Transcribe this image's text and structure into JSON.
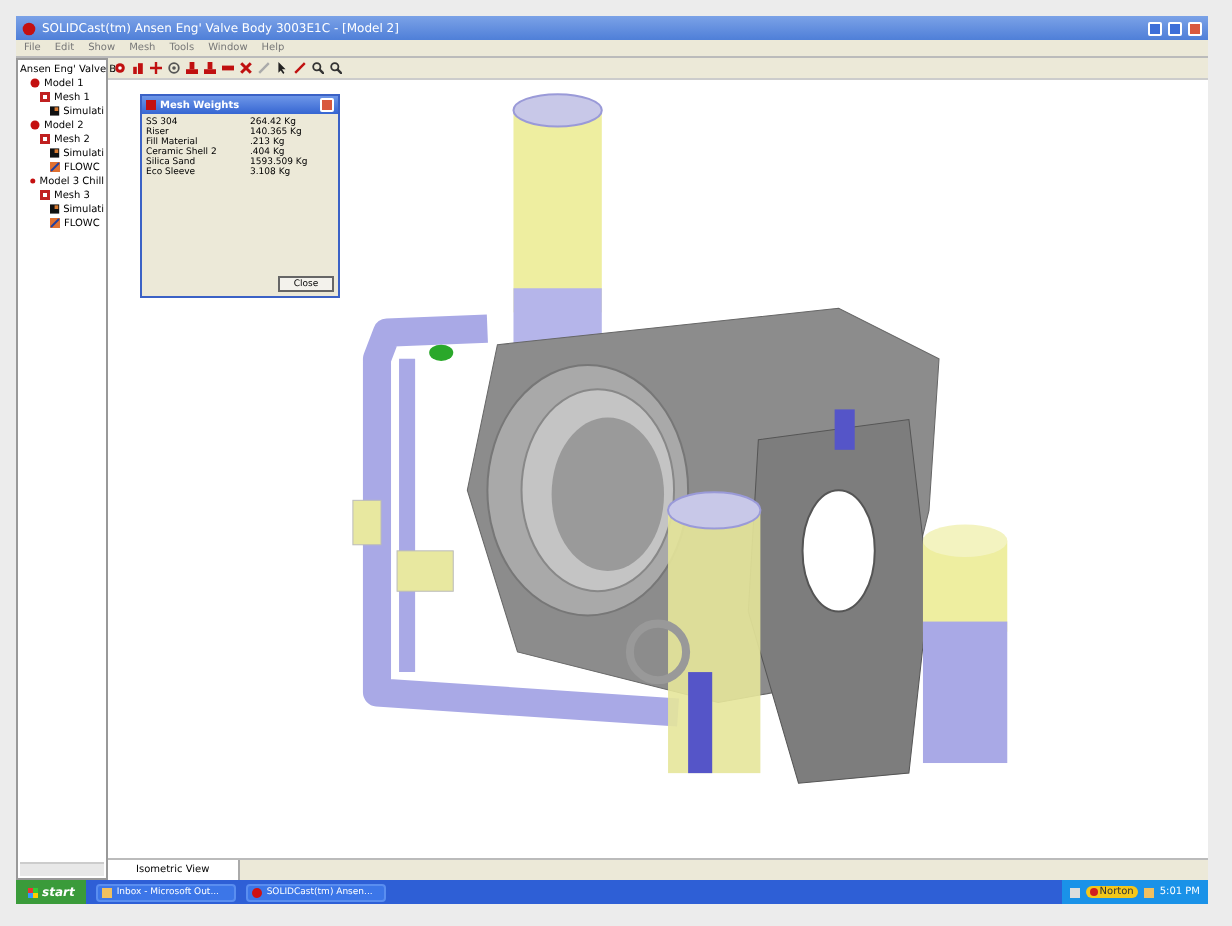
{
  "window": {
    "title": "SOLIDCast(tm) Ansen Eng' Valve Body 3003E1C - [Model 2]"
  },
  "menu": [
    "File",
    "Edit",
    "Show",
    "Mesh",
    "Tools",
    "Window",
    "Help"
  ],
  "tree": {
    "label": "Ansen Eng' Valve B",
    "children": [
      {
        "label": "Model 1",
        "kind": "model",
        "children": [
          {
            "label": "Mesh 1",
            "kind": "mesh",
            "children": [
              {
                "label": "Simulati",
                "kind": "simulation"
              }
            ]
          }
        ]
      },
      {
        "label": "Model 2",
        "kind": "model",
        "children": [
          {
            "label": "Mesh 2",
            "kind": "mesh",
            "children": [
              {
                "label": "Simulati",
                "kind": "simulation"
              },
              {
                "label": "FLOWC",
                "kind": "flow"
              }
            ]
          }
        ]
      },
      {
        "label": "Model 3 Chill",
        "kind": "model",
        "children": [
          {
            "label": "Mesh 3",
            "kind": "mesh",
            "children": [
              {
                "label": "Simulati",
                "kind": "simulation"
              },
              {
                "label": "FLOWC",
                "kind": "flow"
              }
            ]
          }
        ]
      }
    ]
  },
  "dialog": {
    "title": "Mesh Weights",
    "rows": [
      {
        "material": "SS 304",
        "weight": "264.42 Kg"
      },
      {
        "material": "Riser",
        "weight": "140.365 Kg"
      },
      {
        "material": "Fill Material",
        "weight": ".213 Kg"
      },
      {
        "material": "Ceramic Shell 2",
        "weight": ".404 Kg"
      },
      {
        "material": "Silica Sand",
        "weight": "1593.509 Kg"
      },
      {
        "material": "Eco Sleeve",
        "weight": "3.108 Kg"
      }
    ],
    "button": "Close"
  },
  "view_tabs": [
    {
      "label": "Isometric View",
      "selected": true
    }
  ],
  "taskbar": {
    "start": "start",
    "tasks": [
      {
        "label": "Inbox - Microsoft Out...",
        "kind": "mail"
      },
      {
        "label": "SOLIDCast(tm) Ansen...",
        "kind": "app"
      }
    ],
    "tray": {
      "badge": "Norton",
      "clock": "5:01 PM"
    }
  }
}
